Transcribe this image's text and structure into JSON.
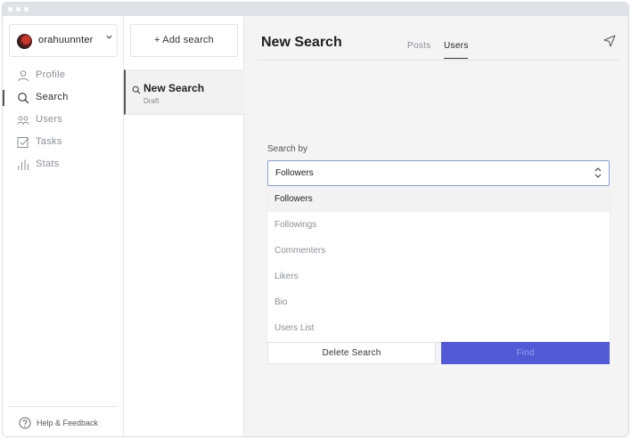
{
  "colors": {
    "accent": "#5159d4",
    "titlebar": "#dfe3e8",
    "panel_bg": "#f4f4f4"
  },
  "user": {
    "name": "orahuunnter"
  },
  "nav": {
    "items": [
      {
        "label": "Profile",
        "icon": "person-icon"
      },
      {
        "label": "Search",
        "icon": "search-icon",
        "active": true
      },
      {
        "label": "Users",
        "icon": "users-icon"
      },
      {
        "label": "Tasks",
        "icon": "tasks-icon"
      },
      {
        "label": "Stats",
        "icon": "stats-icon"
      }
    ]
  },
  "help": {
    "label": "Help & Feedback"
  },
  "searches": {
    "add_label": "+ Add search",
    "items": [
      {
        "title": "New Search",
        "status": "Draft"
      }
    ]
  },
  "main": {
    "title": "New Search",
    "tabs": [
      {
        "label": "Posts"
      },
      {
        "label": "Users",
        "active": true
      }
    ],
    "search_by_label": "Search by",
    "select_value": "Followers",
    "options": [
      "Followers",
      "Followings",
      "Commenters",
      "Likers",
      "Bio",
      "Users List"
    ],
    "delete_label": "Delete Search",
    "find_label": "Find"
  }
}
